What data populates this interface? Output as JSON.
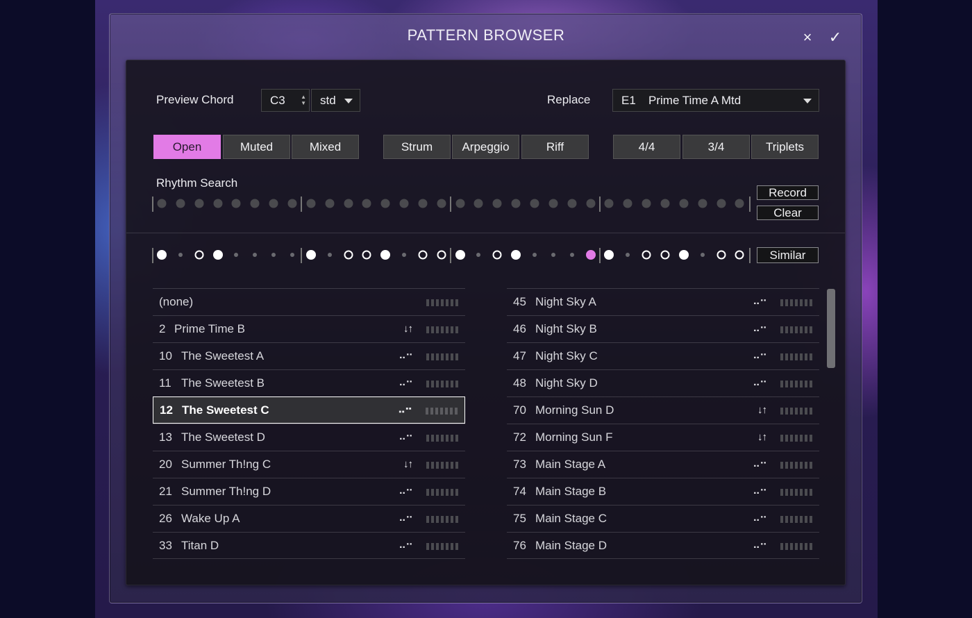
{
  "dialog": {
    "title": "PATTERN BROWSER",
    "close_icon": "×",
    "confirm_icon": "✓"
  },
  "preview": {
    "label": "Preview Chord",
    "chord": "C3",
    "voicing": "std"
  },
  "replace": {
    "label": "Replace",
    "slot": "E1",
    "pattern": "Prime Time A Mtd"
  },
  "filters": {
    "style": [
      {
        "label": "Open",
        "active": true
      },
      {
        "label": "Muted",
        "active": false
      },
      {
        "label": "Mixed",
        "active": false
      }
    ],
    "type": [
      {
        "label": "Strum",
        "active": false
      },
      {
        "label": "Arpeggio",
        "active": false
      },
      {
        "label": "Riff",
        "active": false
      }
    ],
    "meter": [
      {
        "label": "4/4",
        "active": false
      },
      {
        "label": "3/4",
        "active": false
      },
      {
        "label": "Triplets",
        "active": false
      }
    ]
  },
  "rhythm_search": {
    "label": "Rhythm Search",
    "record_label": "Record",
    "clear_label": "Clear",
    "steps": 32
  },
  "similar": {
    "label": "Similar",
    "steps": [
      "filled",
      "small",
      "ring",
      "filled",
      "small",
      "small",
      "small",
      "small",
      "filled",
      "small",
      "ring",
      "ring",
      "filled",
      "small",
      "ring",
      "ring",
      "filled",
      "small",
      "ring",
      "filled",
      "small",
      "small",
      "small",
      "accent",
      "filled",
      "small",
      "ring",
      "ring",
      "filled",
      "small",
      "ring",
      "ring"
    ]
  },
  "icons": {
    "strum": "↓↑",
    "arpeggio": "⠤⠒"
  },
  "colors": {
    "accent": "#e27be6"
  },
  "list_left": [
    {
      "num": "",
      "name": "(none)",
      "icon": ""
    },
    {
      "num": "2",
      "name": "Prime Time B",
      "icon": "↓↑"
    },
    {
      "num": "10",
      "name": "The Sweetest A",
      "icon": "⠤⠒"
    },
    {
      "num": "11",
      "name": "The Sweetest B",
      "icon": "⠤⠒"
    },
    {
      "num": "12",
      "name": "The Sweetest C",
      "icon": "⠤⠒",
      "selected": true
    },
    {
      "num": "13",
      "name": "The Sweetest D",
      "icon": "⠤⠒"
    },
    {
      "num": "20",
      "name": "Summer Th!ng C",
      "icon": "↓↑"
    },
    {
      "num": "21",
      "name": "Summer Th!ng D",
      "icon": "⠤⠒"
    },
    {
      "num": "26",
      "name": "Wake Up A",
      "icon": "⠤⠒"
    },
    {
      "num": "33",
      "name": "Titan D",
      "icon": "⠤⠒"
    }
  ],
  "list_right": [
    {
      "num": "45",
      "name": "Night Sky A",
      "icon": "⠤⠒"
    },
    {
      "num": "46",
      "name": "Night Sky B",
      "icon": "⠤⠒"
    },
    {
      "num": "47",
      "name": "Night Sky C",
      "icon": "⠤⠒"
    },
    {
      "num": "48",
      "name": "Night Sky D",
      "icon": "⠤⠒"
    },
    {
      "num": "70",
      "name": "Morning Sun D",
      "icon": "↓↑"
    },
    {
      "num": "72",
      "name": "Morning Sun F",
      "icon": "↓↑"
    },
    {
      "num": "73",
      "name": "Main Stage A",
      "icon": "⠤⠒"
    },
    {
      "num": "74",
      "name": "Main Stage B",
      "icon": "⠤⠒"
    },
    {
      "num": "75",
      "name": "Main Stage C",
      "icon": "⠤⠒"
    },
    {
      "num": "76",
      "name": "Main Stage D",
      "icon": "⠤⠒"
    }
  ]
}
